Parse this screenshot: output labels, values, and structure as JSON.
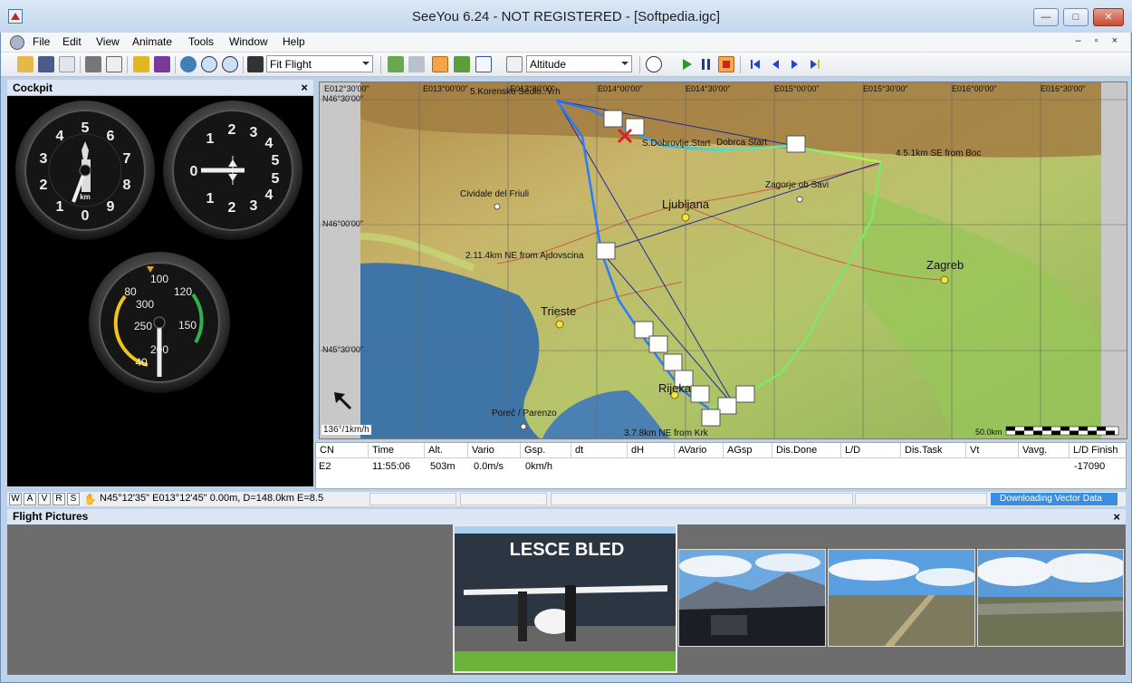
{
  "window": {
    "title": "SeeYou 6.24 - NOT REGISTERED - [Softpedia.igc]",
    "minimize": "—",
    "maximize": "□",
    "close": "✕"
  },
  "menu": {
    "items": [
      "File",
      "Edit",
      "View",
      "Animate",
      "Tools",
      "Window",
      "Help"
    ],
    "mdi_controls": "–  ▫  ×"
  },
  "toolbar": {
    "view_mode": "Fit Flight",
    "graph_mode": "Altitude"
  },
  "cockpit": {
    "title": "Cockpit",
    "close": "×",
    "altimeter_numbers": [
      "0",
      "1",
      "2",
      "3",
      "4",
      "5",
      "6",
      "7",
      "8",
      "9"
    ],
    "altimeter_unit": "km",
    "vario_numbers": [
      "1",
      "2",
      "3",
      "4",
      "5",
      "1",
      "2",
      "3",
      "4",
      "5",
      "0"
    ],
    "asi_numbers": [
      "100",
      "120",
      "150",
      "200",
      "250",
      "300",
      "80",
      "40"
    ]
  },
  "map": {
    "coords": {
      "lon": [
        "E012°30'00\"",
        "E013°00'00\"",
        "E013°30'00\"",
        "E014°00'00\"",
        "E014°30'00\"",
        "E015°00'00\"",
        "E015°30'00\"",
        "E016°00'00\"",
        "E016°30'00\""
      ],
      "lat": [
        "N46°30'00\"",
        "N46°00'00\"",
        "N45°30'00\""
      ]
    },
    "waypoints": {
      "wp5": "5.Korensko Sedlo..Vrh",
      "start": "S.Dobrovlje.Start",
      "start2": "Dobrca Start",
      "wp4": "4.5.1km SE from Boc",
      "wp2": "2.11.4km NE from Ajdovscina",
      "wp3": "3.7.8km NE from Krk"
    },
    "cities": {
      "ljubljana": "Ljubljana",
      "zagreb": "Zagreb",
      "trieste": "Trieste",
      "rijeka": "Rijeka",
      "cividale": "Cividale del Friuli",
      "zagorje": "Zagorje ob Savi",
      "porec": "Poreč / Parenzo"
    },
    "heading_readout": "136°/1km/h",
    "scale_label": "50.0km"
  },
  "flight_table": {
    "columns": [
      "CN",
      "Time",
      "Alt.",
      "Vario",
      "Gsp.",
      "dt",
      "dH",
      "AVario",
      "AGsp",
      "Dis.Done",
      "L/D",
      "Dis.Task",
      "Vt",
      "Vavg.",
      "L/D Finish"
    ],
    "row": {
      "cn": "E2",
      "time": "11:55:06",
      "alt": "503m",
      "vario": "0.0m/s",
      "gsp": "0km/h",
      "ld_finish": "-17090"
    }
  },
  "statusbar": {
    "tabs": [
      "W",
      "A",
      "V",
      "R",
      "S"
    ],
    "coords": "N45°12'35\" E013°12'45\" 0.00m, D=148.0km E=8.5",
    "download": "Downloading Vector Data"
  },
  "pictures": {
    "title": "Flight Pictures",
    "close": "×",
    "hangar_sign": "LESCE   BLED"
  },
  "colors": {
    "accent": "#3b8de0",
    "titlebar": "#c3d7ee",
    "track_start": "#2b5cff",
    "track_end": "#b9f83a"
  }
}
